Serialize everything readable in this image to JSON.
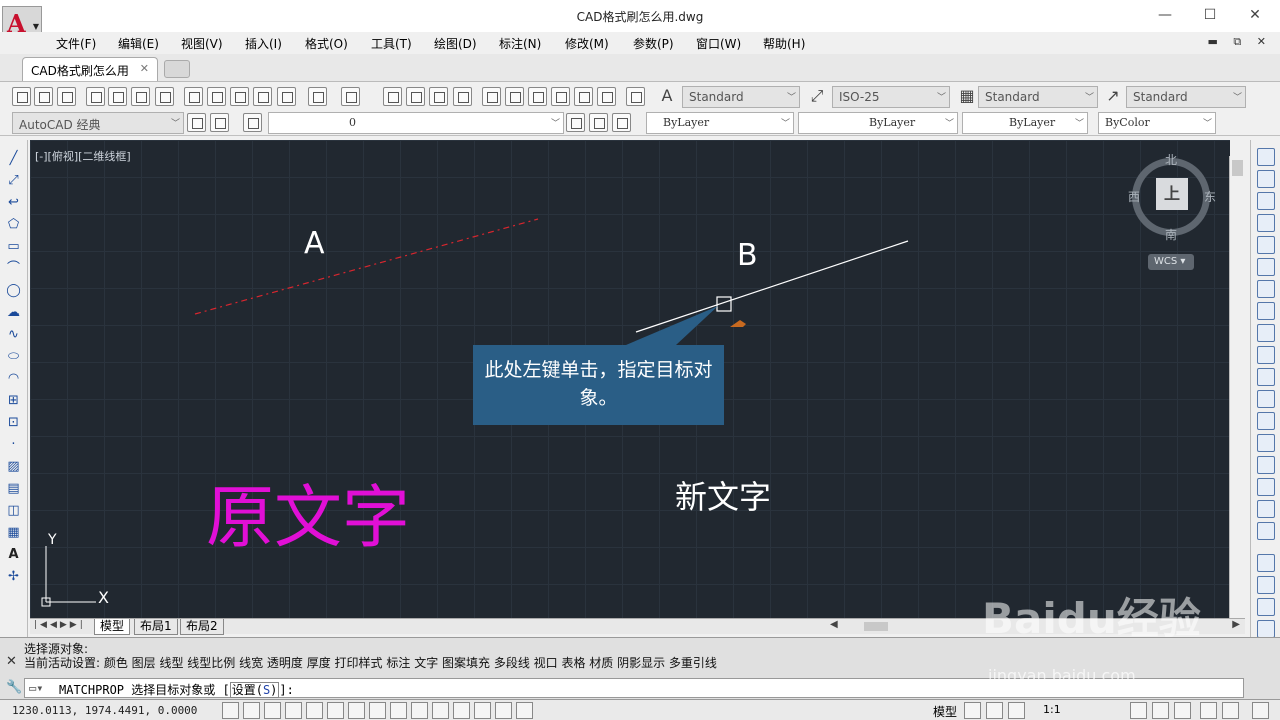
{
  "window": {
    "title": "CAD格式刷怎么用.dwg",
    "minimize": "—",
    "maximize": "☐",
    "close": "✕"
  },
  "menu": [
    "文件(F)",
    "编辑(E)",
    "视图(V)",
    "插入(I)",
    "格式(O)",
    "工具(T)",
    "绘图(D)",
    "标注(N)",
    "修改(M)",
    "参数(P)",
    "窗口(W)",
    "帮助(H)"
  ],
  "doc_tab": {
    "label": "CAD格式刷怎么用",
    "close": "✕"
  },
  "toolbar": {
    "text_style": "Standard",
    "dim_style": "ISO-25",
    "table_style": "Standard",
    "mleader_style": "Standard",
    "workspace": "AutoCAD 经典",
    "layer": "0",
    "color": "ByLayer",
    "linetype": "ByLayer",
    "lineweight": "ByLayer",
    "plotstyle": "ByColor"
  },
  "viewport": {
    "label": "[-][俯视][二维线框]",
    "label_a": "A",
    "label_b": "B",
    "tooltip": "此处左键单击，指定目标对象。",
    "text_old": "原文字",
    "text_new": "新文字",
    "ucs_y": "Y",
    "ucs_x": "X",
    "color_old": "#e10fd6",
    "color_dashed": "#d9262e"
  },
  "navcube": {
    "north": "北",
    "south": "南",
    "west": "西",
    "east": "东",
    "face": "上",
    "wcs": "WCS"
  },
  "layout_tabs": [
    "模型",
    "布局1",
    "布局2"
  ],
  "command": {
    "line1": "选择源对象:",
    "line2": "当前活动设置:  颜色 图层 线型 线型比例 线宽 透明度 厚度 打印样式 标注 文字 图案填充 多段线 视口 表格 材质 阴影显示 多重引线",
    "prompt_prefix": "MATCHPROP 选择目标对象或 [",
    "option": "设置(",
    "option_key": "S",
    "option_end": ")",
    "prompt_suffix": "]:"
  },
  "status": {
    "coords": "1230.0113, 1974.4491, 0.0000",
    "model": "模型",
    "scale": "1:1"
  },
  "watermark": {
    "brand": "Baidu经验",
    "url": "jingyan.baidu.com"
  }
}
